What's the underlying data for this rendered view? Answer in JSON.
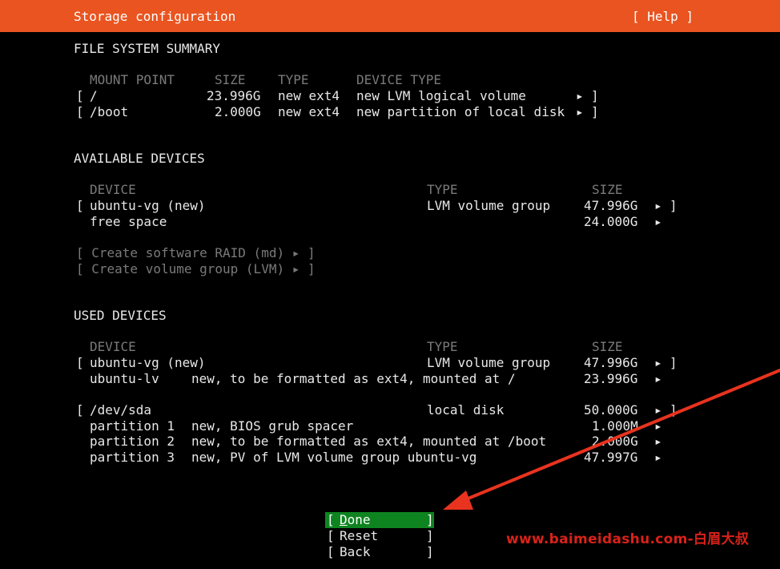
{
  "header": {
    "title": "Storage configuration",
    "help": "[ Help ]"
  },
  "fs_summary": {
    "heading": "FILE SYSTEM SUMMARY",
    "columns": [
      "MOUNT POINT",
      "SIZE",
      "TYPE",
      "DEVICE TYPE"
    ],
    "rows": [
      {
        "open": "[",
        "mount": "/",
        "size": "23.996G",
        "type": "new ext4",
        "device_type": "new LVM logical volume",
        "arrow": "▸",
        "close": "]"
      },
      {
        "open": "[",
        "mount": "/boot",
        "size": "2.000G",
        "type": "new ext4",
        "device_type": "new partition of local disk",
        "arrow": "▸",
        "close": "]"
      }
    ]
  },
  "available": {
    "heading": "AVAILABLE DEVICES",
    "columns": [
      "DEVICE",
      "TYPE",
      "SIZE"
    ],
    "rows": [
      {
        "open": "[",
        "device": "ubuntu-vg (new)",
        "type": "LVM volume group",
        "size": "47.996G",
        "arrow": "▸",
        "close": "]"
      },
      {
        "open": "",
        "device": "free space",
        "type": "",
        "size": "24.000G",
        "arrow": "▸",
        "close": ""
      }
    ],
    "actions": [
      "[ Create software RAID (md) ▸ ]",
      "[ Create volume group (LVM) ▸ ]"
    ]
  },
  "used": {
    "heading": "USED DEVICES",
    "columns": [
      "DEVICE",
      "TYPE",
      "SIZE"
    ],
    "rows": [
      {
        "open": "[",
        "device": "ubuntu-vg (new)",
        "detail": "",
        "type": "LVM volume group",
        "size": "47.996G",
        "arrow": "▸",
        "close": "]"
      },
      {
        "open": "",
        "device": "ubuntu-lv",
        "detail": "new, to be formatted as ext4, mounted at /",
        "type": "",
        "size": "23.996G",
        "arrow": "▸",
        "close": ""
      },
      {
        "open": "[",
        "device": "/dev/sda",
        "detail": "",
        "type": "local disk",
        "size": "50.000G",
        "arrow": "▸",
        "close": "]"
      },
      {
        "open": "",
        "device": "partition 1",
        "detail": "new, BIOS grub spacer",
        "type": "",
        "size": "1.000M",
        "arrow": "▸",
        "close": ""
      },
      {
        "open": "",
        "device": "partition 2",
        "detail": "new, to be formatted as ext4, mounted at /boot",
        "type": "",
        "size": "2.000G",
        "arrow": "▸",
        "close": ""
      },
      {
        "open": "",
        "device": "partition 3",
        "detail": "new, PV of LVM volume group ubuntu-vg",
        "type": "",
        "size": "47.997G",
        "arrow": "▸",
        "close": ""
      }
    ]
  },
  "buttons": {
    "done_first": "D",
    "done_rest": "one",
    "reset": "Reset",
    "back": "Back",
    "left_bracket": "[",
    "right_bracket": "]"
  },
  "watermark": "www.baimeidashu.com-白眉大叔",
  "colors": {
    "header_bg": "#e95420",
    "selected_button_bg": "#0e8420",
    "dim_text": "#7a7a7a",
    "annotation_arrow": "#e8331f"
  }
}
